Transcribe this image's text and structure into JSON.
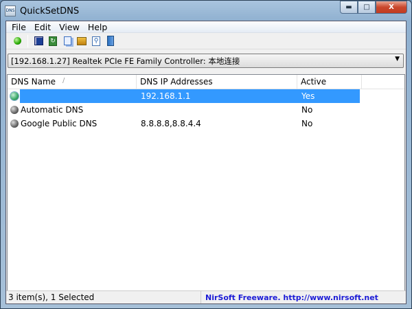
{
  "window": {
    "title": "QuickSetDNS"
  },
  "menu": [
    "File",
    "Edit",
    "View",
    "Help"
  ],
  "toolbar": [
    "activate-icon",
    "save-icon",
    "refresh-icon",
    "copy-icon",
    "properties-icon",
    "find-icon",
    "exit-icon"
  ],
  "adapter": {
    "selected": "[192.168.1.27]  Realtek PCIe FE Family Controller: 本地连接"
  },
  "list": {
    "columns": [
      "DNS Name",
      "DNS IP Addresses",
      "Active"
    ],
    "sort_indicator": "/",
    "rows": [
      {
        "name": "",
        "ips": "192.168.1.1",
        "active": "Yes",
        "selected": true
      },
      {
        "name": "Automatic DNS",
        "ips": "",
        "active": "No"
      },
      {
        "name": "Google Public DNS",
        "ips": "8.8.8.8,8.8.4.4",
        "active": "No"
      }
    ]
  },
  "status": {
    "count": "3 item(s), 1 Selected",
    "link": "NirSoft Freeware.  http://www.nirsoft.net"
  },
  "colors": {
    "selection": "#3399ff",
    "link": "#1b1bd6"
  }
}
